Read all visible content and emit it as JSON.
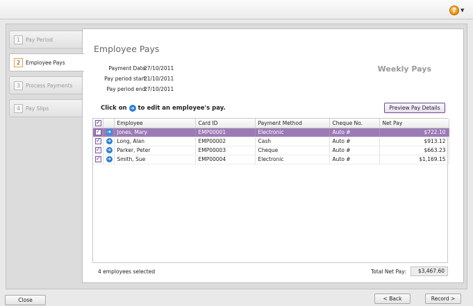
{
  "steps": [
    {
      "num": "1",
      "label": "Pay Period"
    },
    {
      "num": "2",
      "label": "Employee Pays"
    },
    {
      "num": "3",
      "label": "Process Payments"
    },
    {
      "num": "4",
      "label": "Pay Slips"
    }
  ],
  "page": {
    "title": "Employee Pays",
    "section": "Weekly Pays"
  },
  "info": {
    "payment_date_label": "Payment Date:",
    "payment_date": "27/10/2011",
    "start_label": "Pay period start:",
    "start": "21/10/2011",
    "end_label": "Pay period end:",
    "end": "27/10/2011"
  },
  "hint": {
    "prefix": "Click on",
    "suffix": "to edit an employee's pay."
  },
  "preview_button": "Preview Pay Details",
  "table": {
    "columns": [
      "Employee",
      "Card ID",
      "Payment Method",
      "Cheque No.",
      "Net Pay"
    ],
    "rows": [
      {
        "employee": "Jones, Mary",
        "card": "EMP00001",
        "method": "Electronic",
        "cheque": "Auto #",
        "net": "$722.10"
      },
      {
        "employee": "Long, Alan",
        "card": "EMP00002",
        "method": "Cash",
        "cheque": "Auto #",
        "net": "$913.12"
      },
      {
        "employee": "Parker, Peter",
        "card": "EMP00003",
        "method": "Cheque",
        "cheque": "Auto #",
        "net": "$663.23"
      },
      {
        "employee": "Smith, Sue",
        "card": "EMP00004",
        "method": "Electronic",
        "cheque": "Auto #",
        "net": "$1,169.15"
      }
    ]
  },
  "footer": {
    "selected_text": "4 employees selected",
    "total_label": "Total Net Pay:",
    "total_value": "$3,467.60"
  },
  "buttons": {
    "close": "Close",
    "back": "< Back",
    "record": "Record >"
  },
  "colors": {
    "selected_row": "#9b7bb5",
    "accent_orange": "#f08a00",
    "arrow_blue": "#2a7fd4"
  }
}
